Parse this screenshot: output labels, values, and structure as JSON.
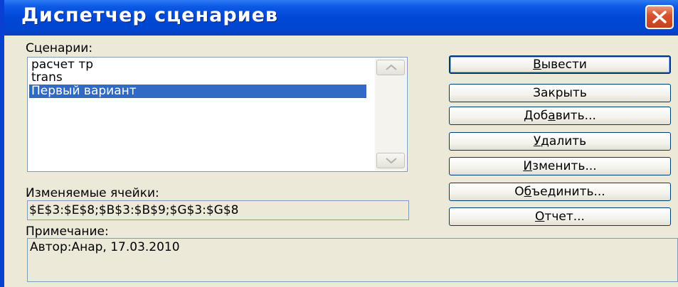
{
  "window": {
    "title": "Диспетчер сценариев"
  },
  "scenarios": {
    "label": "Сценарии:",
    "items": [
      {
        "label": "расчет тр",
        "selected": false
      },
      {
        "label": "trans",
        "selected": false
      },
      {
        "label": "Первый вариант",
        "selected": true
      }
    ]
  },
  "changing_cells": {
    "label": "Изменяемые ячейки:",
    "value": "$E$3:$E$8;$B$3:$B$9;$G$3:$G$8"
  },
  "comment": {
    "label": "Примечание:",
    "value": "Автор:Анар, 17.03.2010"
  },
  "buttons": [
    {
      "name": "show-button",
      "pre": "",
      "key": "В",
      "post": "ывести",
      "default": true
    },
    {
      "name": "close-button",
      "pre": "Закрыть",
      "key": "",
      "post": "",
      "default": false
    },
    {
      "name": "add-button",
      "pre": "Доб",
      "key": "а",
      "post": "вить...",
      "default": false
    },
    {
      "name": "delete-button",
      "pre": "",
      "key": "У",
      "post": "далить",
      "default": false
    },
    {
      "name": "edit-button",
      "pre": "",
      "key": "И",
      "post": "зменить...",
      "default": false
    },
    {
      "name": "merge-button",
      "pre": "О",
      "key": "б",
      "post": "ъединить...",
      "default": false
    },
    {
      "name": "report-button",
      "pre": "",
      "key": "О",
      "post": "тчет...",
      "default": false
    }
  ],
  "colors": {
    "titlebar": "#0047d8",
    "selection": "#316ac5",
    "dialog_bg": "#ece9d8",
    "close_button": "#d8542e"
  }
}
